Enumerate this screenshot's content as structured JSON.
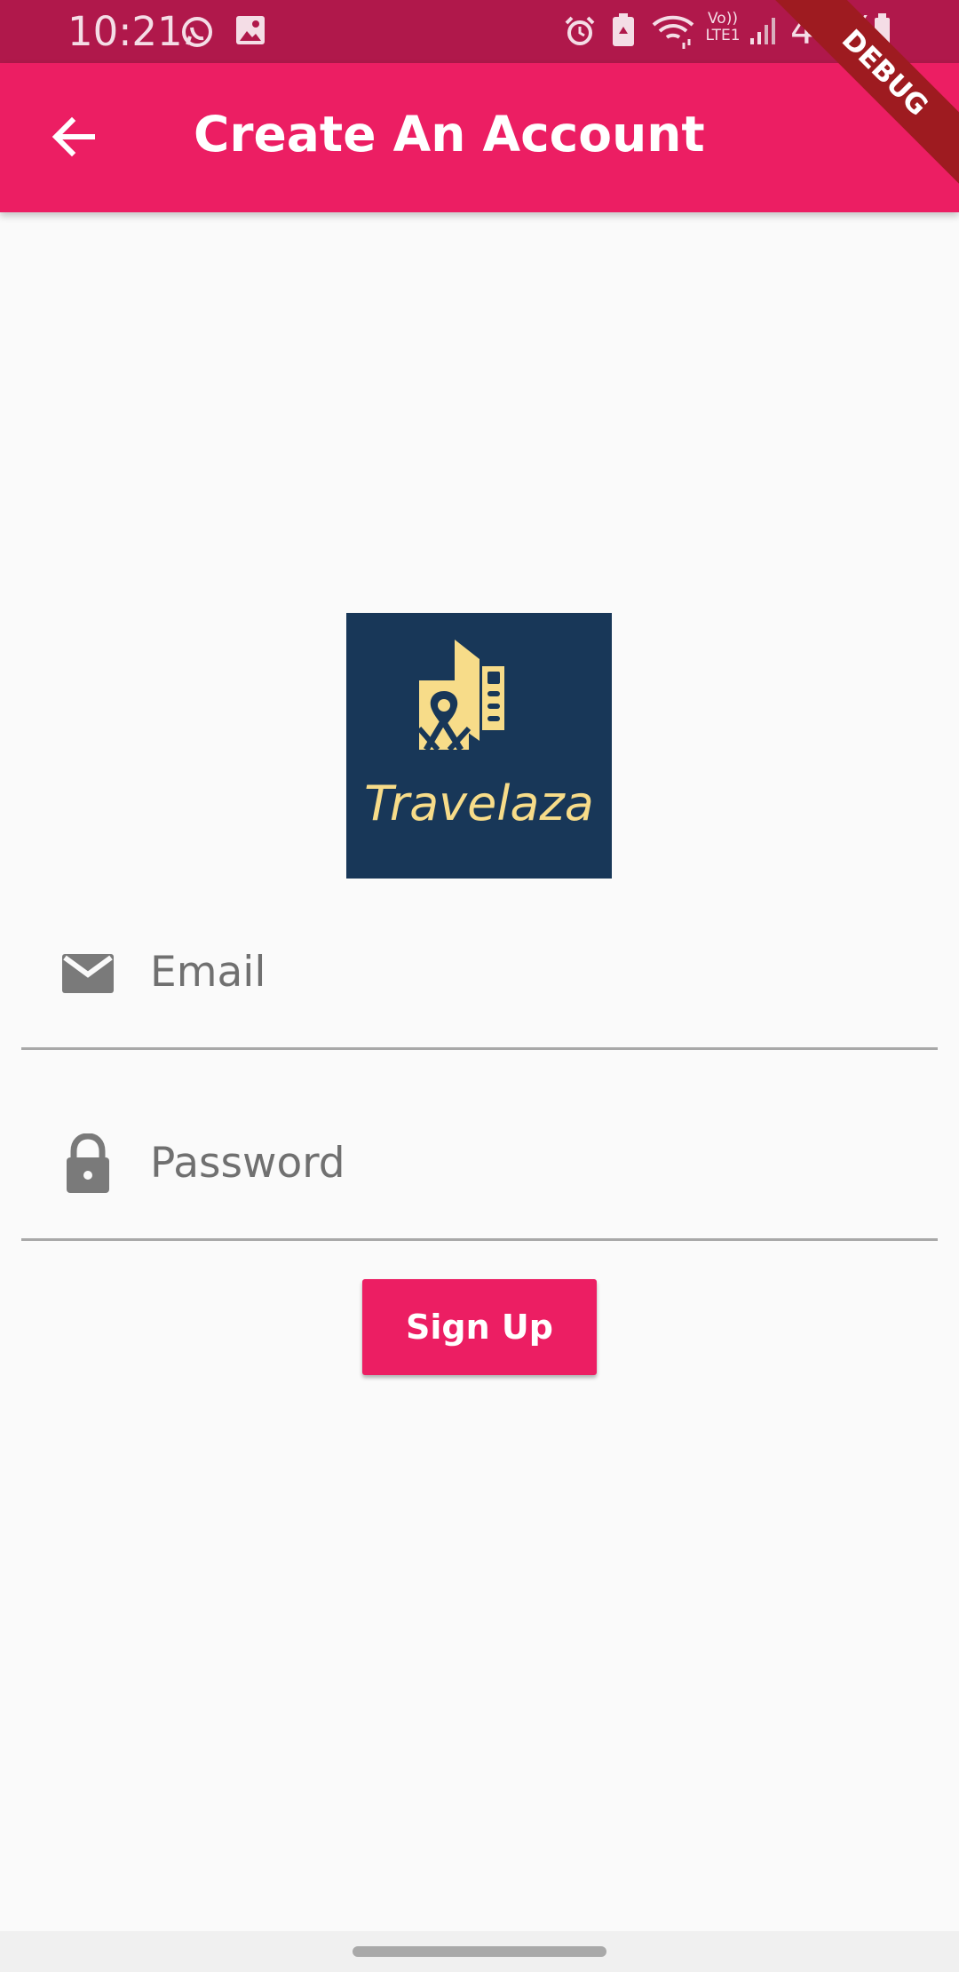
{
  "status_bar": {
    "time": "10:21",
    "battery": "48%",
    "network_label": "Vo)) LTE1",
    "icons": [
      "whatsapp-icon",
      "image-icon",
      "alarm-icon",
      "battery-saver-icon",
      "wifi-icon",
      "signal-icon",
      "battery-icon"
    ]
  },
  "app_bar": {
    "title": "Create An Account",
    "back_icon": "arrow-left-icon",
    "background": "#ec1e63",
    "status_background": "#b0184b"
  },
  "debug_banner": {
    "label": "DEBUG"
  },
  "logo": {
    "text": "Travelaza",
    "background": "#183758",
    "accent": "#f7dc89"
  },
  "form": {
    "email": {
      "placeholder": "Email",
      "value": "",
      "icon": "mail-icon"
    },
    "password": {
      "placeholder": "Password",
      "value": "",
      "icon": "lock-icon"
    },
    "submit_label": "Sign Up"
  }
}
